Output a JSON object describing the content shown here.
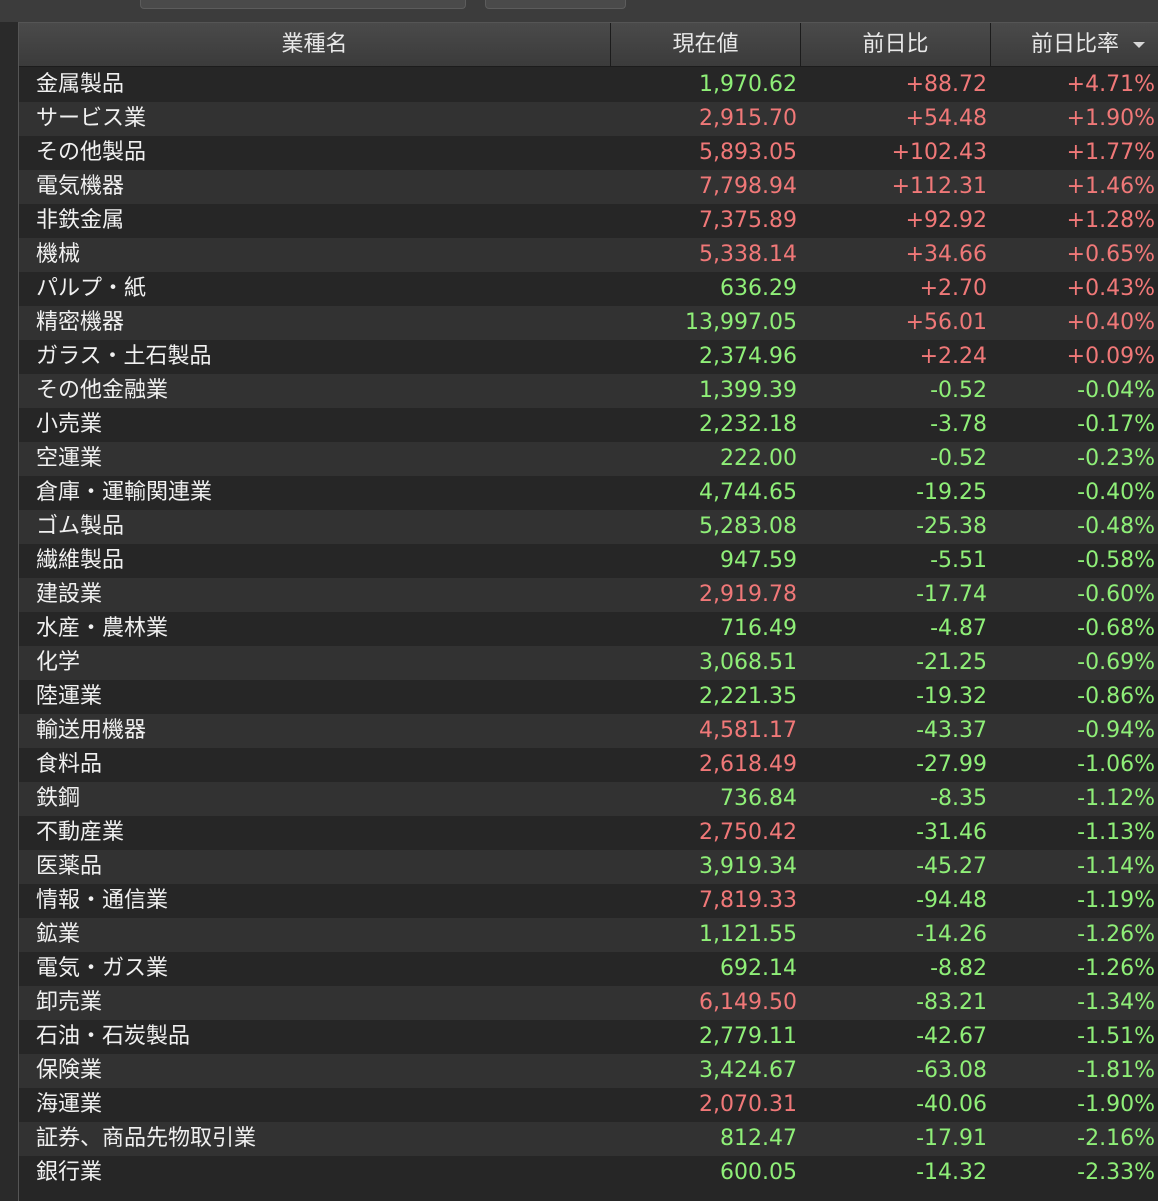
{
  "colors": {
    "up": "#f07878",
    "down": "#8fef78"
  },
  "header": {
    "name": "業種名",
    "price": "現在値",
    "change": "前日比",
    "change_pct": "前日比率",
    "sort_icon": "sort-descending-icon"
  },
  "rows": [
    {
      "name": "金属製品",
      "price": "1,970.62",
      "price_dir": "down",
      "change": "+88.72",
      "change_pct": "+4.71%",
      "dir": "up"
    },
    {
      "name": "サービス業",
      "price": "2,915.70",
      "price_dir": "up",
      "change": "+54.48",
      "change_pct": "+1.90%",
      "dir": "up"
    },
    {
      "name": "その他製品",
      "price": "5,893.05",
      "price_dir": "up",
      "change": "+102.43",
      "change_pct": "+1.77%",
      "dir": "up"
    },
    {
      "name": "電気機器",
      "price": "7,798.94",
      "price_dir": "up",
      "change": "+112.31",
      "change_pct": "+1.46%",
      "dir": "up"
    },
    {
      "name": "非鉄金属",
      "price": "7,375.89",
      "price_dir": "up",
      "change": "+92.92",
      "change_pct": "+1.28%",
      "dir": "up"
    },
    {
      "name": "機械",
      "price": "5,338.14",
      "price_dir": "up",
      "change": "+34.66",
      "change_pct": "+0.65%",
      "dir": "up"
    },
    {
      "name": "パルプ・紙",
      "price": "636.29",
      "price_dir": "down",
      "change": "+2.70",
      "change_pct": "+0.43%",
      "dir": "up"
    },
    {
      "name": "精密機器",
      "price": "13,997.05",
      "price_dir": "down",
      "change": "+56.01",
      "change_pct": "+0.40%",
      "dir": "up"
    },
    {
      "name": "ガラス・土石製品",
      "price": "2,374.96",
      "price_dir": "down",
      "change": "+2.24",
      "change_pct": "+0.09%",
      "dir": "up"
    },
    {
      "name": "その他金融業",
      "price": "1,399.39",
      "price_dir": "down",
      "change": "-0.52",
      "change_pct": "-0.04%",
      "dir": "down"
    },
    {
      "name": "小売業",
      "price": "2,232.18",
      "price_dir": "down",
      "change": "-3.78",
      "change_pct": "-0.17%",
      "dir": "down"
    },
    {
      "name": "空運業",
      "price": "222.00",
      "price_dir": "down",
      "change": "-0.52",
      "change_pct": "-0.23%",
      "dir": "down"
    },
    {
      "name": "倉庫・運輸関連業",
      "price": "4,744.65",
      "price_dir": "down",
      "change": "-19.25",
      "change_pct": "-0.40%",
      "dir": "down"
    },
    {
      "name": "ゴム製品",
      "price": "5,283.08",
      "price_dir": "down",
      "change": "-25.38",
      "change_pct": "-0.48%",
      "dir": "down"
    },
    {
      "name": "繊維製品",
      "price": "947.59",
      "price_dir": "down",
      "change": "-5.51",
      "change_pct": "-0.58%",
      "dir": "down"
    },
    {
      "name": "建設業",
      "price": "2,919.78",
      "price_dir": "up",
      "change": "-17.74",
      "change_pct": "-0.60%",
      "dir": "down"
    },
    {
      "name": "水産・農林業",
      "price": "716.49",
      "price_dir": "down",
      "change": "-4.87",
      "change_pct": "-0.68%",
      "dir": "down"
    },
    {
      "name": "化学",
      "price": "3,068.51",
      "price_dir": "down",
      "change": "-21.25",
      "change_pct": "-0.69%",
      "dir": "down"
    },
    {
      "name": "陸運業",
      "price": "2,221.35",
      "price_dir": "down",
      "change": "-19.32",
      "change_pct": "-0.86%",
      "dir": "down"
    },
    {
      "name": "輸送用機器",
      "price": "4,581.17",
      "price_dir": "up",
      "change": "-43.37",
      "change_pct": "-0.94%",
      "dir": "down"
    },
    {
      "name": "食料品",
      "price": "2,618.49",
      "price_dir": "up",
      "change": "-27.99",
      "change_pct": "-1.06%",
      "dir": "down"
    },
    {
      "name": "鉄鋼",
      "price": "736.84",
      "price_dir": "down",
      "change": "-8.35",
      "change_pct": "-1.12%",
      "dir": "down"
    },
    {
      "name": "不動産業",
      "price": "2,750.42",
      "price_dir": "up",
      "change": "-31.46",
      "change_pct": "-1.13%",
      "dir": "down"
    },
    {
      "name": "医薬品",
      "price": "3,919.34",
      "price_dir": "down",
      "change": "-45.27",
      "change_pct": "-1.14%",
      "dir": "down"
    },
    {
      "name": "情報・通信業",
      "price": "7,819.33",
      "price_dir": "up",
      "change": "-94.48",
      "change_pct": "-1.19%",
      "dir": "down"
    },
    {
      "name": "鉱業",
      "price": "1,121.55",
      "price_dir": "down",
      "change": "-14.26",
      "change_pct": "-1.26%",
      "dir": "down"
    },
    {
      "name": "電気・ガス業",
      "price": "692.14",
      "price_dir": "down",
      "change": "-8.82",
      "change_pct": "-1.26%",
      "dir": "down"
    },
    {
      "name": "卸売業",
      "price": "6,149.50",
      "price_dir": "up",
      "change": "-83.21",
      "change_pct": "-1.34%",
      "dir": "down"
    },
    {
      "name": "石油・石炭製品",
      "price": "2,779.11",
      "price_dir": "down",
      "change": "-42.67",
      "change_pct": "-1.51%",
      "dir": "down"
    },
    {
      "name": "保険業",
      "price": "3,424.67",
      "price_dir": "down",
      "change": "-63.08",
      "change_pct": "-1.81%",
      "dir": "down"
    },
    {
      "name": "海運業",
      "price": "2,070.31",
      "price_dir": "up",
      "change": "-40.06",
      "change_pct": "-1.90%",
      "dir": "down"
    },
    {
      "name": "証券、商品先物取引業",
      "price": "812.47",
      "price_dir": "down",
      "change": "-17.91",
      "change_pct": "-2.16%",
      "dir": "down"
    },
    {
      "name": "銀行業",
      "price": "600.05",
      "price_dir": "down",
      "change": "-14.32",
      "change_pct": "-2.33%",
      "dir": "down"
    }
  ]
}
